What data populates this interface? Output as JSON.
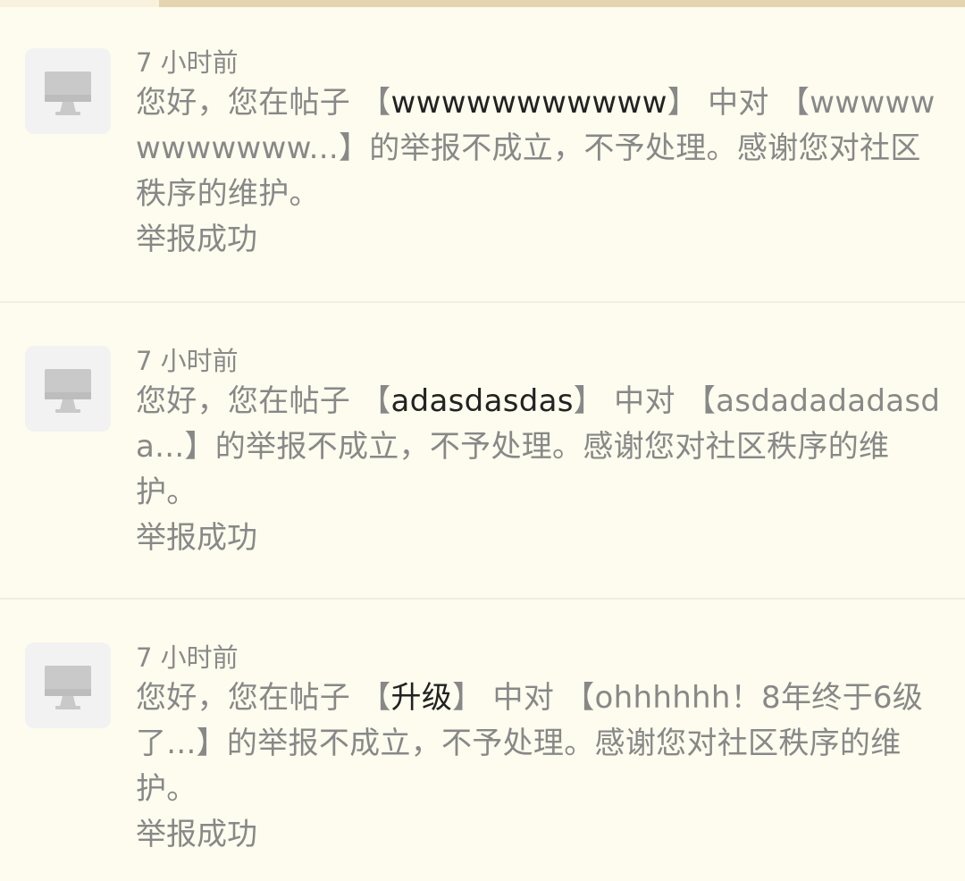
{
  "progress": {
    "fraction": 0.165
  },
  "notifications": [
    {
      "time": "7 小时前",
      "msg_a": "您好，您在帖子 【",
      "post_title": "wwwwwwwwwww",
      "msg_b": "】 中对 【wwwwwwwwwwww...】的举报不成立，不予处理。感谢您对社区秩序的维护。",
      "status": "举报成功"
    },
    {
      "time": "7 小时前",
      "msg_a": "您好，您在帖子 【",
      "post_title": "adasdasdas",
      "msg_b": "】 中对 【asdadadadasda...】的举报不成立，不予处理。感谢您对社区秩序的维护。",
      "status": "举报成功"
    },
    {
      "time": "7 小时前",
      "msg_a": "您好，您在帖子 【",
      "post_title": "升级",
      "msg_b": "】 中对 【ohhhhhh！8年终于6级了...】的举报不成立，不予处理。感谢您对社区秩序的维护。",
      "status": "举报成功"
    }
  ],
  "colors": {
    "background": "#fdfcee",
    "muted_text": "#888888",
    "highlight_text": "#222222",
    "avatar_bg": "#f2f2f2",
    "progress_track": "#e4d5b0"
  },
  "icons": {
    "avatar": "monitor-icon"
  }
}
